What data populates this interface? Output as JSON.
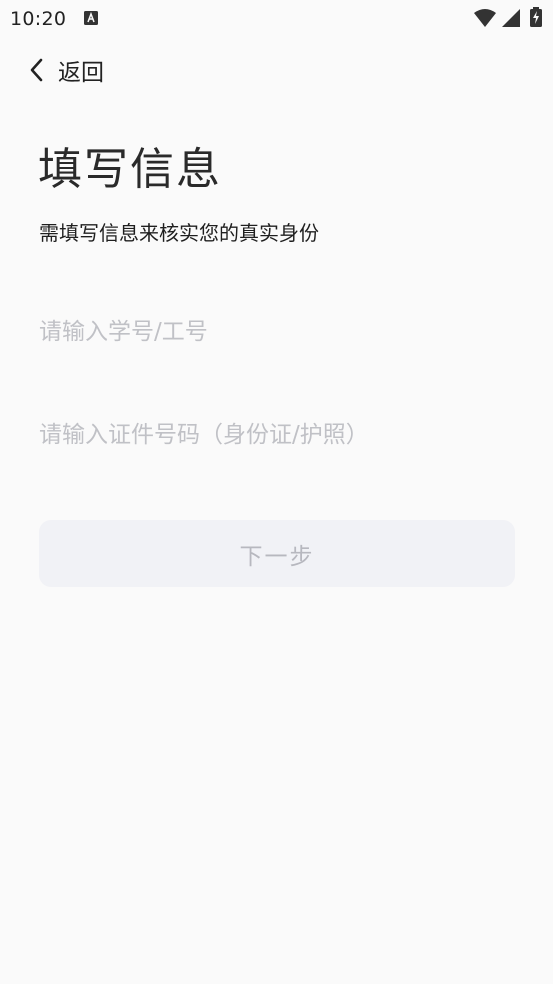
{
  "status_bar": {
    "time": "10:20",
    "notification_icon": "font-a-icon",
    "icons": [
      "wifi-icon",
      "signal-icon",
      "battery-charging-icon"
    ]
  },
  "header": {
    "back_label": "返回",
    "back_icon": "chevron-left-icon"
  },
  "main": {
    "title": "填写信息",
    "subtitle": "需填写信息来核实您的真实身份",
    "student_id_placeholder": "请输入学号/工号",
    "id_card_placeholder": "请输入证件号码（身份证/护照）",
    "next_label": "下一步"
  },
  "colors": {
    "background": "#fafafa",
    "placeholder": "#c0c1c6",
    "button_bg": "#f1f2f6",
    "button_text": "#b7b8bf"
  }
}
